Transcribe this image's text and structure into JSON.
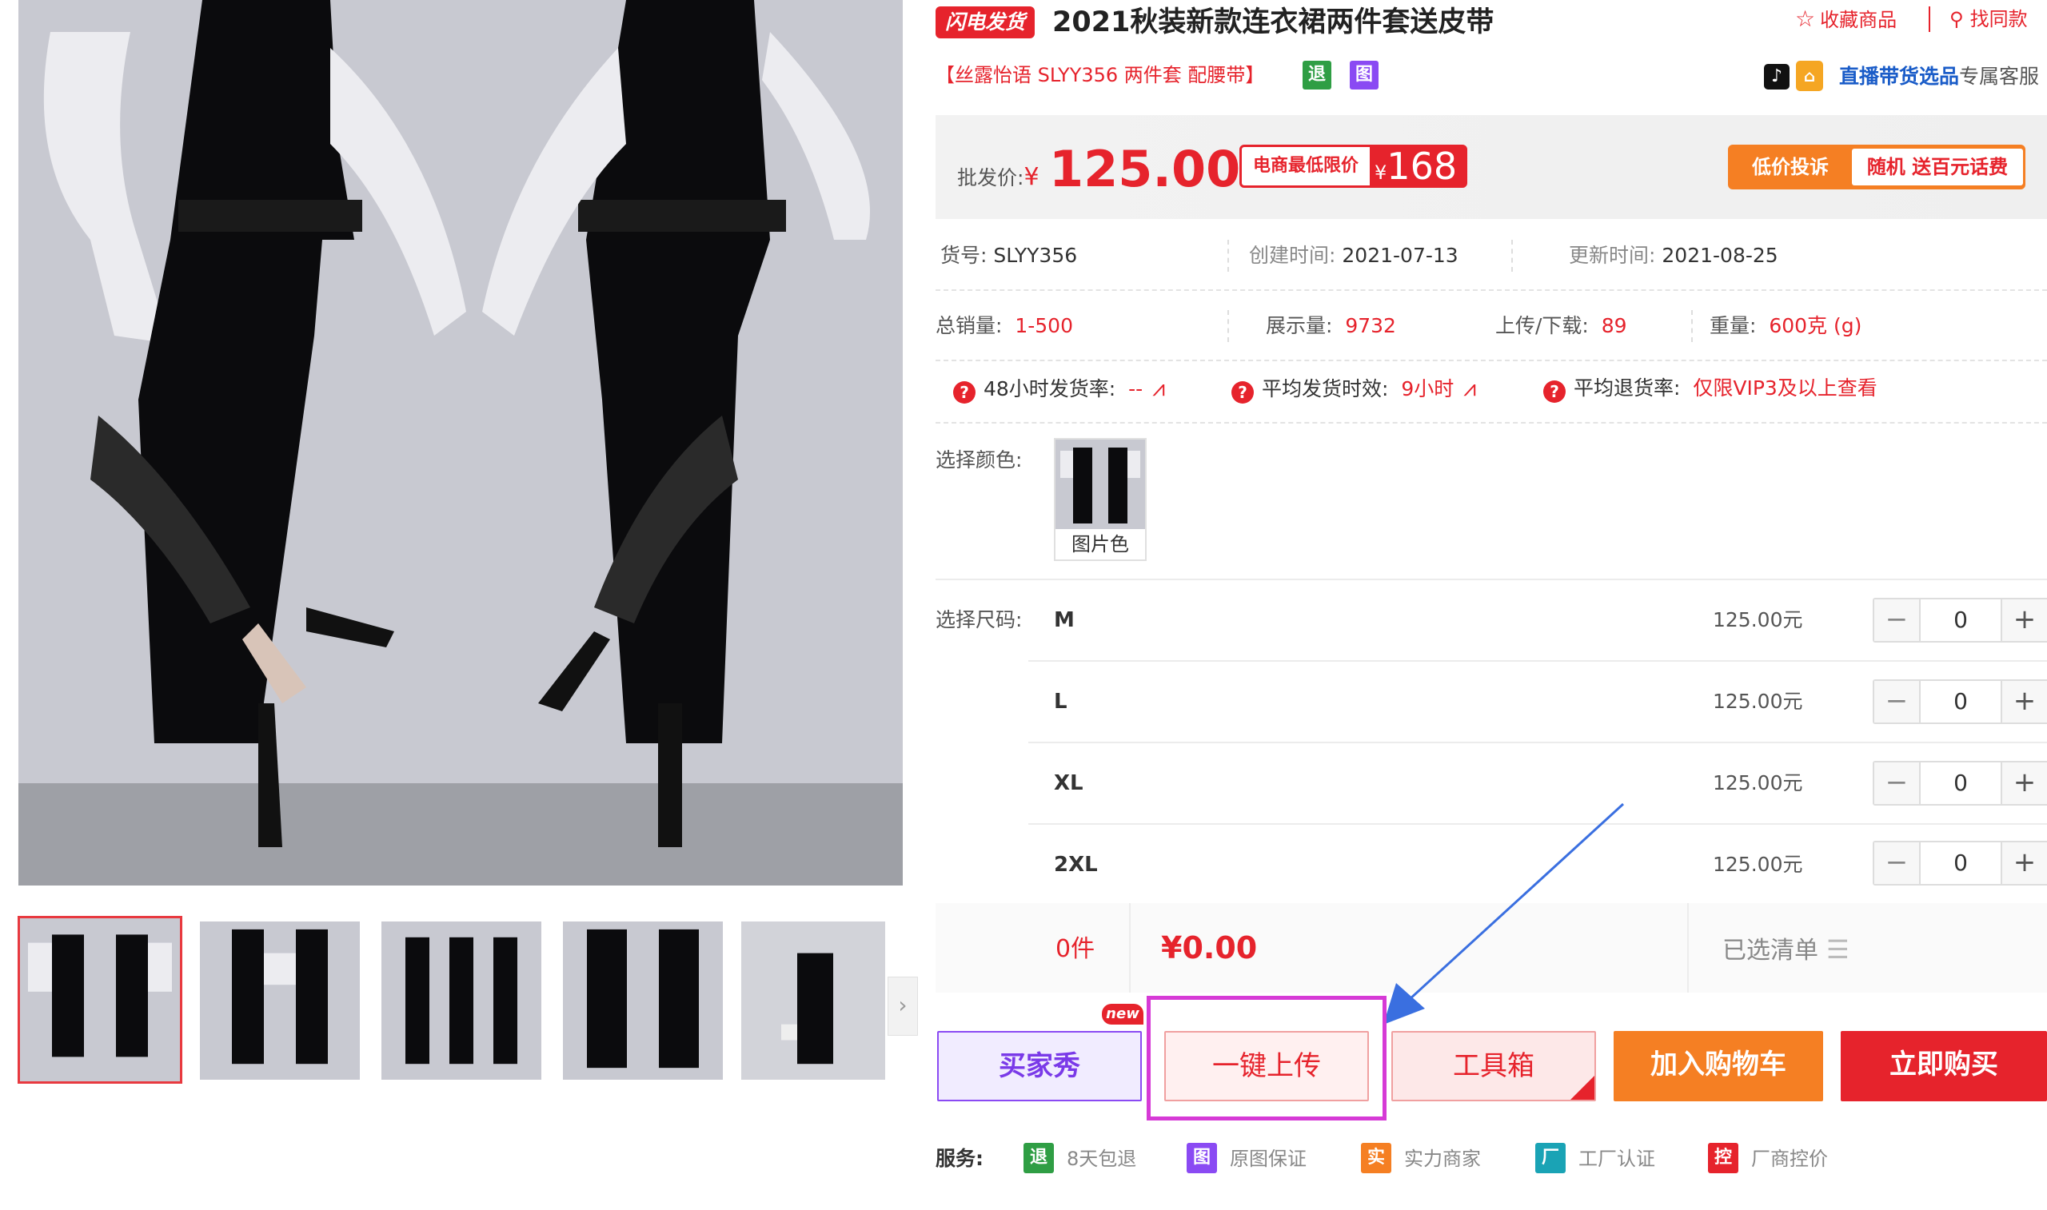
{
  "product": {
    "flash_badge": "闪电发货",
    "title": "2021秋装新款连衣裙两件套送皮带",
    "subtitle": "【丝露怡语 SLYY356 两件套 配腰带】",
    "tag_return": "退",
    "tag_image": "图"
  },
  "header_actions": {
    "favorite": "收藏商品",
    "find_similar": "找同款"
  },
  "live": {
    "link_text": "直播带货选品",
    "tail_text": "专属客服"
  },
  "price": {
    "label": "批发价:",
    "currency": "¥",
    "value": "125.00",
    "min_label": "电商最低限价",
    "min_currency": "¥",
    "min_value": "168",
    "complain_left": "低价投诉",
    "complain_right": "随机 送百元话费"
  },
  "meta": {
    "sku_label": "货号:",
    "sku": "SLYY356",
    "created_label": "创建时间:",
    "created": "2021-07-13",
    "updated_label": "更新时间:",
    "updated": "2021-08-25",
    "sales_label": "总销量:",
    "sales": "1-500",
    "views_label": "展示量:",
    "views": "9732",
    "uploads_label": "上传/下载:",
    "uploads": "89",
    "weight_label": "重量:",
    "weight": "600克 (g)"
  },
  "rates": {
    "ship48_label": "48小时发货率:",
    "ship48": "--",
    "avg_ship_label": "平均发货时效:",
    "avg_ship": "9小时",
    "return_label": "平均退货率:",
    "return_value": "仅限VIP3及以上查看"
  },
  "color": {
    "label": "选择颜色:",
    "option": "图片色"
  },
  "sizes": {
    "label": "选择尺码:",
    "rows": [
      {
        "name": "M",
        "price": "125.00元",
        "qty": "0"
      },
      {
        "name": "L",
        "price": "125.00元",
        "qty": "0"
      },
      {
        "name": "XL",
        "price": "125.00元",
        "qty": "0"
      },
      {
        "name": "2XL",
        "price": "125.00元",
        "qty": "0"
      }
    ],
    "minus": "−",
    "plus": "+"
  },
  "summary": {
    "count": "0件",
    "total": "¥0.00",
    "list": "已选清单"
  },
  "buttons": {
    "buyer_show": "买家秀",
    "new_tag": "new",
    "upload": "一键上传",
    "tools": "工具箱",
    "cart": "加入购物车",
    "buy": "立即购买"
  },
  "services": {
    "label": "服务:",
    "items": [
      {
        "icon": "退",
        "text": "8天包退",
        "color": "#2f9e44"
      },
      {
        "icon": "图",
        "text": "原图保证",
        "color": "#8a4af3"
      },
      {
        "icon": "实",
        "text": "实力商家",
        "color": "#f57f23"
      },
      {
        "icon": "厂",
        "text": "工厂认证",
        "color": "#1aa3b5"
      },
      {
        "icon": "控",
        "text": "厂商控价",
        "color": "#e6232c"
      }
    ]
  },
  "gallery": {
    "next": "›"
  },
  "colors": {
    "accent": "#e6232c",
    "orange": "#f57f23",
    "purple": "#8a4af3",
    "link_blue": "#1a5cc8",
    "highlight": "#d63ad6"
  }
}
